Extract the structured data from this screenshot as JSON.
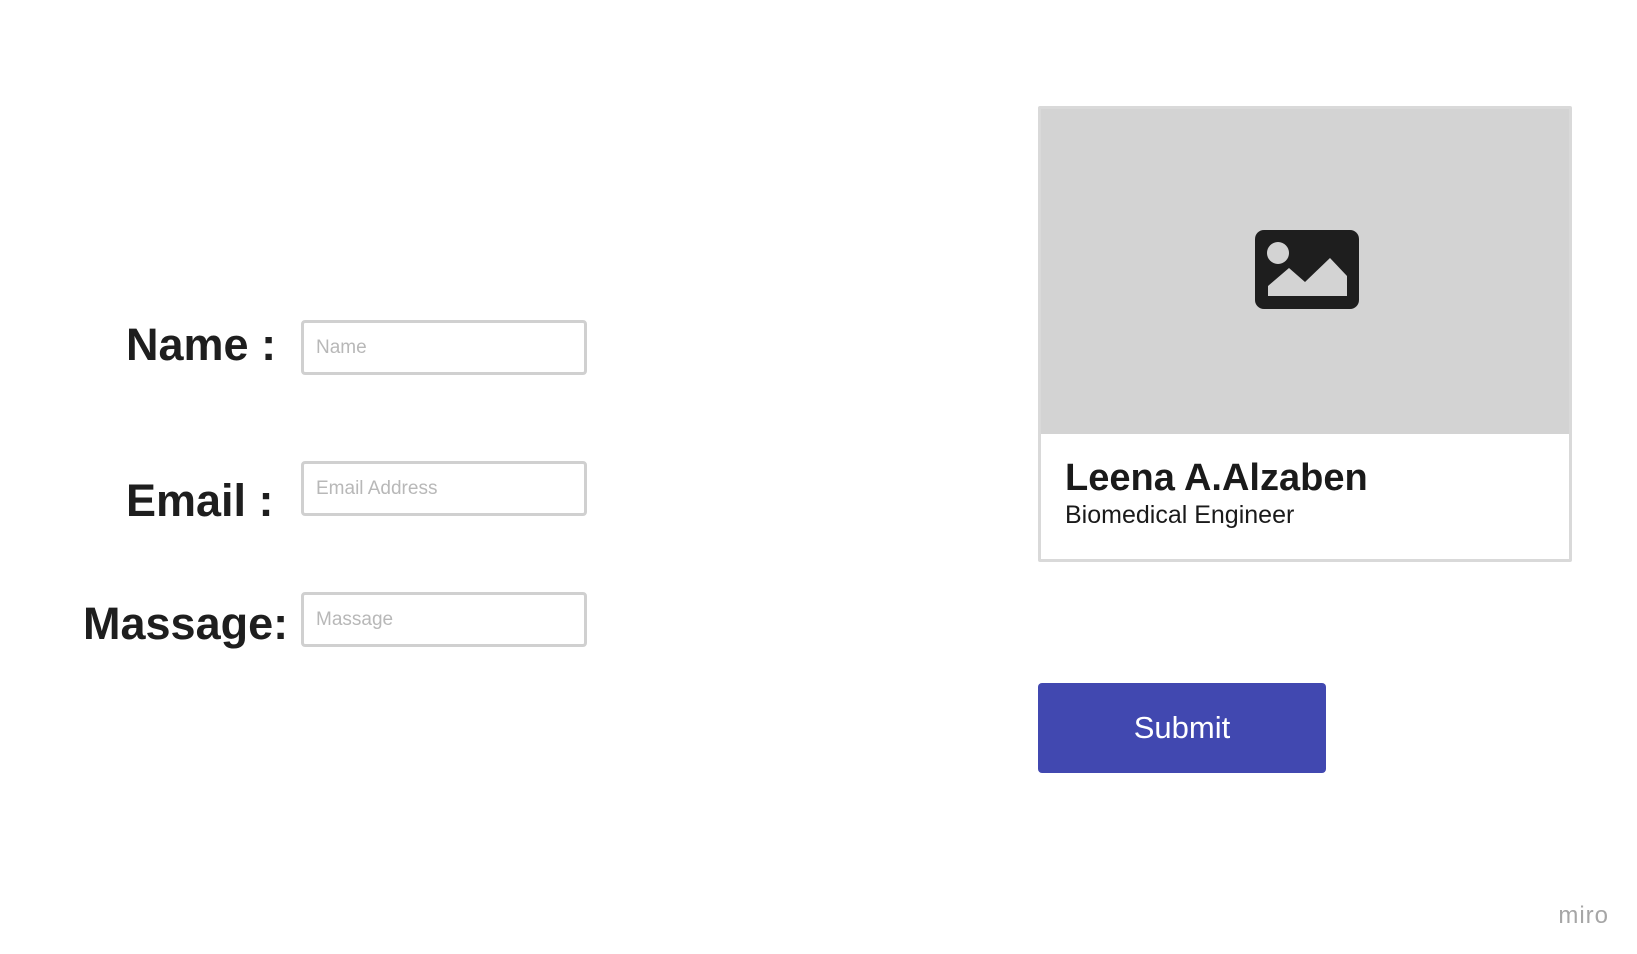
{
  "form": {
    "name_label": "Name :",
    "name_placeholder": "Name",
    "email_label": "Email :",
    "email_placeholder": "Email Address",
    "message_label": "Massage:",
    "message_placeholder": "Massage"
  },
  "profile_card": {
    "image_icon": "image-placeholder-icon",
    "name": "Leena A.Alzaben",
    "title": "Biomedical Engineer"
  },
  "submit_label": "Submit",
  "watermark": "miro",
  "colors": {
    "accent": "#4148b0",
    "image_placeholder_bg": "#d3d3d3",
    "input_border": "#d0d0d0",
    "label_text": "#1e1e1e",
    "watermark": "#a6a6a6"
  }
}
